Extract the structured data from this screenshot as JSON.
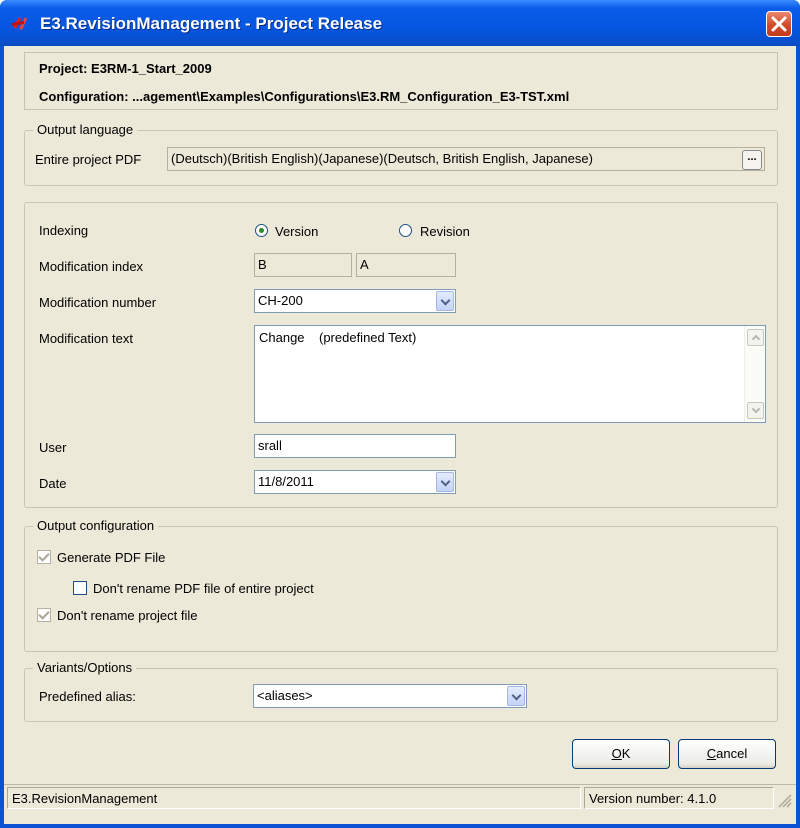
{
  "window": {
    "title": "E3.RevisionManagement - Project Release",
    "app_icon": "e3-logo-icon",
    "close_icon": "close-icon"
  },
  "header": {
    "project_label": "Project:",
    "project_value": "E3RM-1_Start_2009",
    "config_label": "Configuration:",
    "config_value": "...agement\\Examples\\Configurations\\E3.RM_Configuration_E3-TST.xml"
  },
  "output_language": {
    "legend": "Output language",
    "label": "Entire project PDF",
    "value": "(Deutsch)(British English)(Japanese)(Deutsch, British English, Japanese)",
    "browse_label": "..."
  },
  "indexing": {
    "label": "Indexing",
    "options": [
      "Version",
      "Revision"
    ],
    "selected": "Version"
  },
  "modification_index": {
    "label": "Modification index",
    "value1": "B",
    "value2": "A"
  },
  "modification_number": {
    "label": "Modification number",
    "value": "CH-200"
  },
  "modification_text": {
    "label": "Modification text",
    "value": "Change    (predefined Text)"
  },
  "user": {
    "label": "User",
    "value": "srall"
  },
  "date": {
    "label": "Date",
    "value": "11/8/2011"
  },
  "output_configuration": {
    "legend": "Output configuration",
    "generate_pdf": {
      "label": "Generate PDF File",
      "checked": true
    },
    "dont_rename_pdf": {
      "label": "Don't rename PDF file of entire project",
      "checked": false
    },
    "dont_rename_project": {
      "label": "Don't rename project file",
      "checked": true
    }
  },
  "variants": {
    "legend": "Variants/Options",
    "label": "Predefined alias:",
    "value": "<aliases>"
  },
  "buttons": {
    "ok_mnemonic": "O",
    "ok_rest": "K",
    "cancel_mnemonic": "C",
    "cancel_rest": "ancel"
  },
  "statusbar": {
    "left": "E3.RevisionManagement",
    "right": "Version number: 4.1.0"
  },
  "colors": {
    "titlebar": "#0556e0",
    "dialog_bg": "#ece9d8",
    "close_button": "#d24a2a"
  }
}
